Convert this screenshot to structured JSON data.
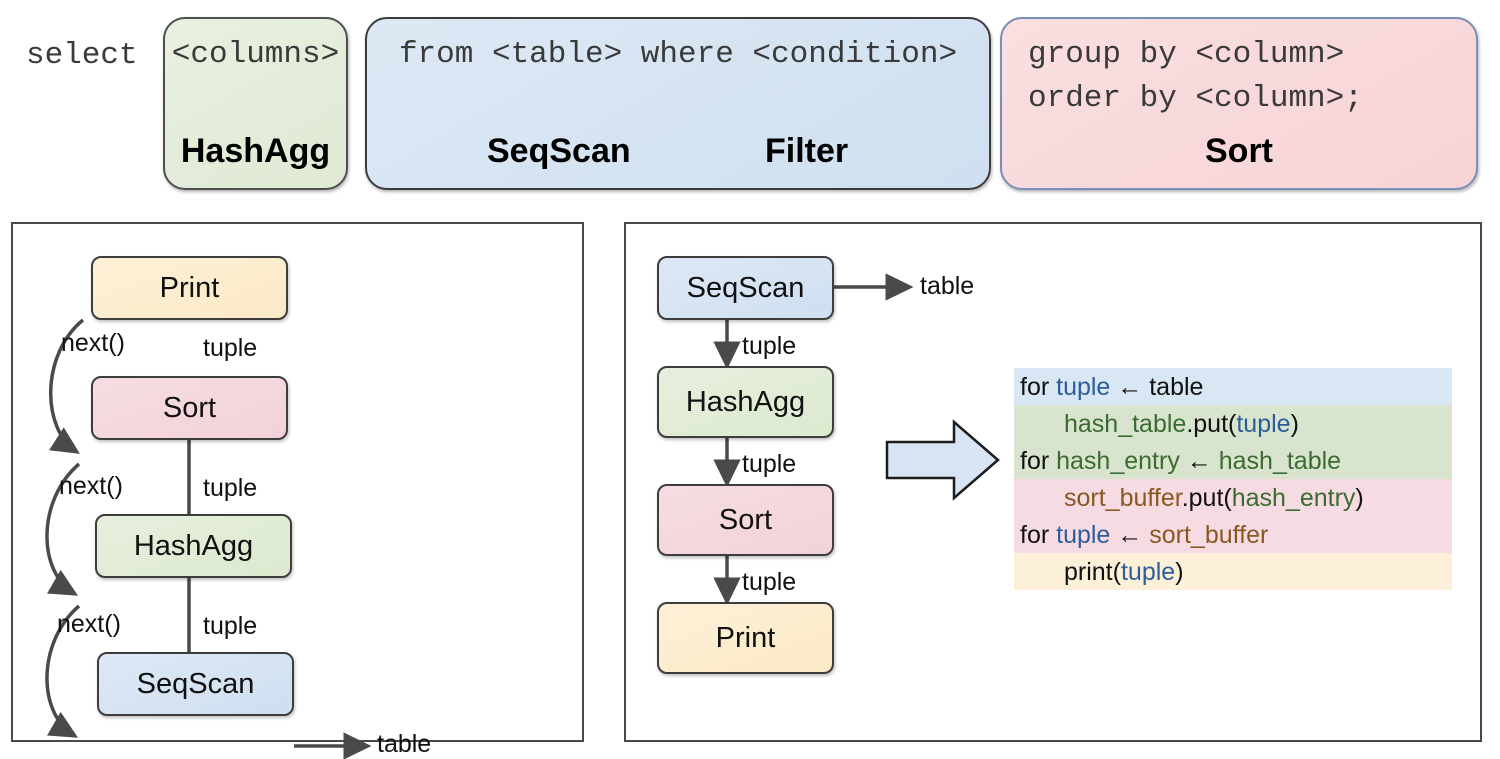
{
  "sql_strip": {
    "prefix": "select",
    "boxes": [
      {
        "id": "hashagg",
        "sql_lines": [
          "<columns>"
        ],
        "operator": "HashAgg",
        "fill": "#e4edda",
        "border": "#4f4f4f"
      },
      {
        "id": "seqscan",
        "sql_lines": [
          "from <table> where <condition>"
        ],
        "operators": [
          "SeqScan",
          "Filter"
        ],
        "fill": "#d6e4f2",
        "border": "#3c3c3c"
      },
      {
        "id": "sort",
        "sql_lines": [
          "group by <column>",
          "order by <column>;"
        ],
        "operator": "Sort",
        "fill": "#f9d9dc",
        "border": "#7a8fb5"
      }
    ]
  },
  "volcano_panel": {
    "nodes": [
      {
        "id": "print",
        "label": "Print",
        "color": "#fbeccd"
      },
      {
        "id": "sort",
        "label": "Sort",
        "color": "#f4d8de"
      },
      {
        "id": "hashagg",
        "label": "HashAgg",
        "color": "#e2ecd6"
      },
      {
        "id": "seqscan",
        "label": "SeqScan",
        "color": "#d6e4f3"
      }
    ],
    "call_labels": [
      "next()",
      "next()",
      "next()"
    ],
    "data_labels": [
      "tuple",
      "tuple",
      "tuple"
    ],
    "sink_label": "table"
  },
  "pipeline_panel": {
    "nodes": [
      {
        "id": "seqscan",
        "label": "SeqScan",
        "color": "#d6e4f3"
      },
      {
        "id": "hashagg",
        "label": "HashAgg",
        "color": "#e2ecd6"
      },
      {
        "id": "sort",
        "label": "Sort",
        "color": "#f4d8de"
      },
      {
        "id": "print",
        "label": "Print",
        "color": "#fbeccd"
      }
    ],
    "data_labels": [
      "tuple",
      "tuple",
      "tuple"
    ],
    "source_label": "table",
    "transform_arrow": "right-arrow-icon",
    "code": {
      "bands": [
        {
          "color": "#d9e7f5",
          "lines": 1
        },
        {
          "color": "#d9e4ce",
          "lines": 2
        },
        {
          "color": "#f6dce2",
          "lines": 2
        },
        {
          "color": "#fcf0d8",
          "lines": 1
        }
      ],
      "lines": [
        {
          "indent": 0,
          "tokens": [
            {
              "t": "for ",
              "c": "plain"
            },
            {
              "t": "tuple",
              "c": "tuple"
            },
            {
              "t": " ← table",
              "c": "plain"
            }
          ]
        },
        {
          "indent": 1,
          "tokens": [
            {
              "t": "hash_table",
              "c": "hash"
            },
            {
              "t": ".put(",
              "c": "plain"
            },
            {
              "t": "tuple",
              "c": "tuple"
            },
            {
              "t": ")",
              "c": "plain"
            }
          ]
        },
        {
          "indent": 0,
          "tokens": [
            {
              "t": "for ",
              "c": "plain"
            },
            {
              "t": "hash_entry",
              "c": "hash"
            },
            {
              "t": " ← ",
              "c": "plain"
            },
            {
              "t": "hash_table",
              "c": "hash"
            }
          ]
        },
        {
          "indent": 1,
          "tokens": [
            {
              "t": "sort_buffer",
              "c": "sortbuf"
            },
            {
              "t": ".put(",
              "c": "plain"
            },
            {
              "t": "hash_entry",
              "c": "hash"
            },
            {
              "t": ")",
              "c": "plain"
            }
          ]
        },
        {
          "indent": 0,
          "tokens": [
            {
              "t": "for ",
              "c": "plain"
            },
            {
              "t": "tuple",
              "c": "tuple"
            },
            {
              "t": " ← ",
              "c": "plain"
            },
            {
              "t": "sort_buffer",
              "c": "sortbuf"
            }
          ]
        },
        {
          "indent": 1,
          "tokens": [
            {
              "t": "print(",
              "c": "plain"
            },
            {
              "t": "tuple",
              "c": "tuple"
            },
            {
              "t": ")",
              "c": "plain"
            }
          ]
        }
      ]
    }
  },
  "colors": {
    "blue": "#d6e4f3",
    "green": "#e2ecd6",
    "pink": "#f4d8de",
    "cream": "#fbeccd",
    "stroke": "#4a4a4a",
    "token_tuple": "#2d5d99",
    "token_hash": "#3b6b30",
    "token_sortbuf": "#8a5722"
  }
}
